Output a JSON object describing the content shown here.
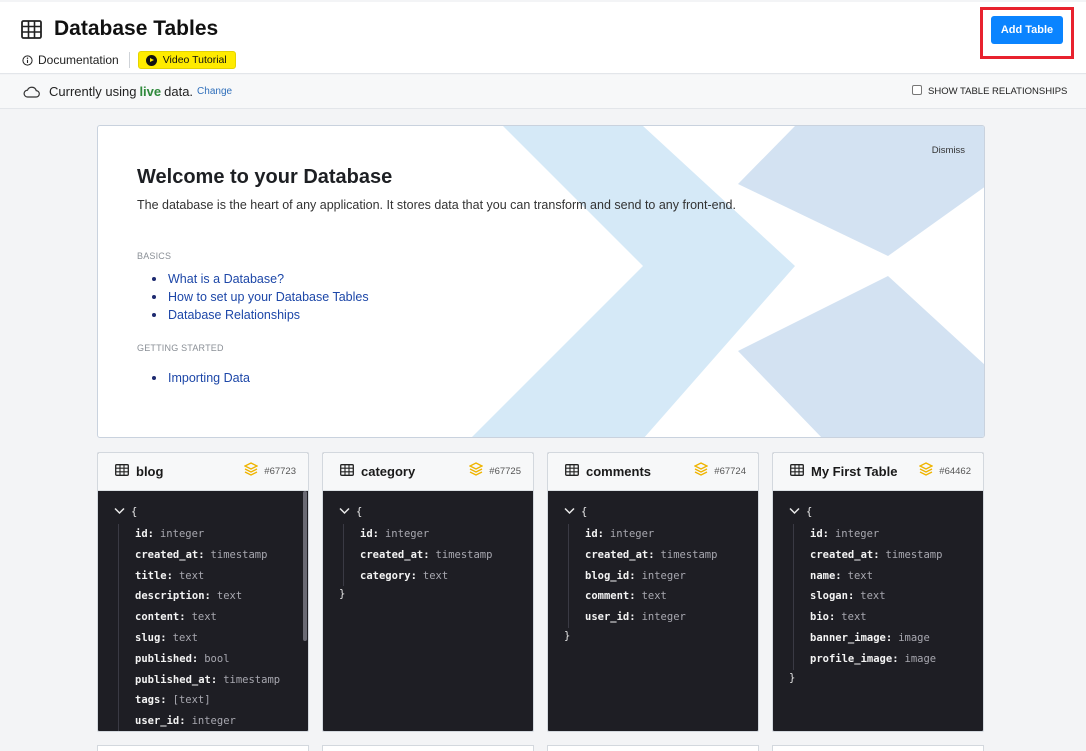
{
  "header": {
    "title": "Database Tables",
    "title_icon": "table-icon",
    "documentation_label": "Documentation",
    "video_tutorial_label": "Video Tutorial",
    "add_table_label": "Add Table"
  },
  "status": {
    "prefix": "Currently using",
    "mode": "live",
    "suffix": "data.",
    "change_label": "Change",
    "show_relationships_label": "SHOW TABLE RELATIONSHIPS",
    "show_relationships_checked": false
  },
  "welcome": {
    "dismiss_label": "Dismiss",
    "title": "Welcome to your Database",
    "description": "The database is the heart of any application. It stores data that you can transform and send to any front-end.",
    "sections": [
      {
        "label": "BASICS",
        "links": [
          "What is a Database?",
          "How to set up your Database Tables",
          "Database Relationships"
        ]
      },
      {
        "label": "GETTING STARTED",
        "links": [
          "Importing Data"
        ]
      }
    ]
  },
  "tables": [
    {
      "name": "blog",
      "id": "#67723",
      "fields": [
        {
          "name": "id",
          "type": "integer"
        },
        {
          "name": "created_at",
          "type": "timestamp"
        },
        {
          "name": "title",
          "type": "text"
        },
        {
          "name": "description",
          "type": "text"
        },
        {
          "name": "content",
          "type": "text"
        },
        {
          "name": "slug",
          "type": "text"
        },
        {
          "name": "published",
          "type": "bool"
        },
        {
          "name": "published_at",
          "type": "timestamp"
        },
        {
          "name": "tags",
          "type": "[text]"
        },
        {
          "name": "user_id",
          "type": "integer"
        }
      ]
    },
    {
      "name": "category",
      "id": "#67725",
      "fields": [
        {
          "name": "id",
          "type": "integer"
        },
        {
          "name": "created_at",
          "type": "timestamp"
        },
        {
          "name": "category",
          "type": "text"
        }
      ]
    },
    {
      "name": "comments",
      "id": "#67724",
      "fields": [
        {
          "name": "id",
          "type": "integer"
        },
        {
          "name": "created_at",
          "type": "timestamp"
        },
        {
          "name": "blog_id",
          "type": "integer"
        },
        {
          "name": "comment",
          "type": "text"
        },
        {
          "name": "user_id",
          "type": "integer"
        }
      ]
    },
    {
      "name": "My First Table",
      "id": "#64462",
      "fields": [
        {
          "name": "id",
          "type": "integer"
        },
        {
          "name": "created_at",
          "type": "timestamp"
        },
        {
          "name": "name",
          "type": "text"
        },
        {
          "name": "slogan",
          "type": "text"
        },
        {
          "name": "bio",
          "type": "text"
        },
        {
          "name": "banner_image",
          "type": "image"
        },
        {
          "name": "profile_image",
          "type": "image"
        }
      ]
    }
  ],
  "schema_open_brace": "{",
  "schema_close_brace": "}",
  "colors": {
    "accent": "#0a84ff",
    "live": "#2f8a3c",
    "video_button": "#ffeb00",
    "highlight": "#e8222e",
    "schema_bg": "#1e1e24",
    "stack_icon": "#f0b400"
  }
}
